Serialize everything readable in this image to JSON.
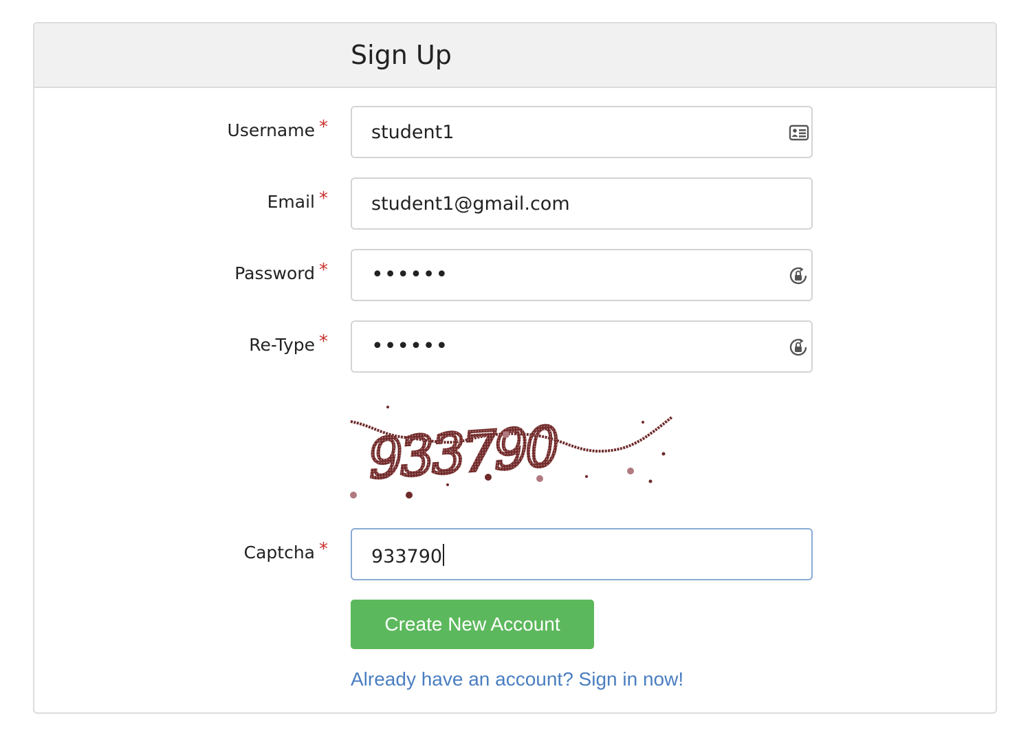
{
  "header": {
    "title": "Sign Up"
  },
  "form": {
    "username": {
      "label": "Username",
      "required_mark": "*",
      "value": "student1",
      "icon": "id-card-icon"
    },
    "email": {
      "label": "Email",
      "required_mark": "*",
      "value": "student1@gmail.com"
    },
    "password": {
      "label": "Password",
      "required_mark": "*",
      "masked_value": "••••••",
      "icon": "lock-refresh-icon"
    },
    "retype": {
      "label": "Re-Type",
      "required_mark": "*",
      "masked_value": "••••••",
      "icon": "lock-refresh-icon"
    },
    "captcha_image": {
      "digits": "933790"
    },
    "captcha": {
      "label": "Captcha",
      "required_mark": "*",
      "value": "933790"
    }
  },
  "actions": {
    "create_label": "Create New Account",
    "signin_link": "Already have an account? Sign in now!"
  },
  "colors": {
    "accent_green": "#5cb85c",
    "link_blue": "#4a7ec0",
    "required_red": "#c9302c",
    "captcha_ink": "#6e2a2a"
  }
}
